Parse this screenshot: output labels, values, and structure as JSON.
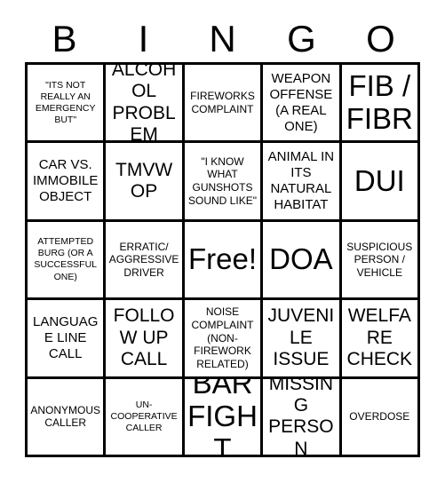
{
  "card": {
    "title": "BINGO",
    "header_letters": [
      "B",
      "I",
      "N",
      "G",
      "O"
    ],
    "free_space_index": 12,
    "colors": {
      "border": "#000000",
      "cell_background": "#ffffff",
      "text": "#000000",
      "page_background": "#ffffff"
    },
    "grid_size": "5x5",
    "cells": [
      {
        "text": "\"ITS NOT REALLY AN EMERGENCY BUT\"",
        "size": "xs",
        "column": "B",
        "row": 1
      },
      {
        "text": "ALCOHOL PROBLEM",
        "size": "lg",
        "column": "I",
        "row": 1
      },
      {
        "text": "FIREWORKS COMPLAINT",
        "size": "sm",
        "column": "N",
        "row": 1
      },
      {
        "text": "WEAPON OFFENSE (A REAL ONE)",
        "size": "md",
        "column": "G",
        "row": 1
      },
      {
        "text": "FIB / FIBR",
        "size": "xxl",
        "column": "O",
        "row": 1
      },
      {
        "text": "CAR VS. IMMOBILE OBJECT",
        "size": "md",
        "column": "B",
        "row": 2
      },
      {
        "text": "TMVWOP",
        "size": "lg",
        "column": "I",
        "row": 2
      },
      {
        "text": "\"I KNOW WHAT GUNSHOTS SOUND LIKE\"",
        "size": "sm",
        "column": "N",
        "row": 2
      },
      {
        "text": "ANIMAL IN ITS NATURAL HABITAT",
        "size": "md",
        "column": "G",
        "row": 2
      },
      {
        "text": "DUI",
        "size": "xxl",
        "column": "O",
        "row": 2
      },
      {
        "text": "ATTEMPTED BURG (OR A SUCCESSFUL ONE)",
        "size": "xs",
        "column": "B",
        "row": 3
      },
      {
        "text": "ERRATIC/ AGGRESSIVE DRIVER",
        "size": "sm",
        "column": "I",
        "row": 3
      },
      {
        "text": "Free!",
        "size": "xxl",
        "column": "N",
        "row": 3
      },
      {
        "text": "DOA",
        "size": "xxl",
        "column": "G",
        "row": 3
      },
      {
        "text": "SUSPICIOUS PERSON / VEHICLE",
        "size": "sm",
        "column": "O",
        "row": 3
      },
      {
        "text": "LANGUAGE LINE CALL",
        "size": "md",
        "column": "B",
        "row": 4
      },
      {
        "text": "FOLLOW UP CALL",
        "size": "lg",
        "column": "I",
        "row": 4
      },
      {
        "text": "NOISE COMPLAINT (NON-FIREWORK RELATED)",
        "size": "sm",
        "column": "N",
        "row": 4
      },
      {
        "text": "JUVENILE ISSUE",
        "size": "lg",
        "column": "G",
        "row": 4
      },
      {
        "text": "WELFARE CHECK",
        "size": "lg",
        "column": "O",
        "row": 4
      },
      {
        "text": "ANONYMOUS CALLER",
        "size": "sm",
        "column": "B",
        "row": 5
      },
      {
        "text": "UN-COOPERATIVE CALLER",
        "size": "xs",
        "column": "I",
        "row": 5
      },
      {
        "text": "BAR FIGHT",
        "size": "xxl",
        "column": "N",
        "row": 5
      },
      {
        "text": "MISSING PERSON",
        "size": "lg",
        "column": "G",
        "row": 5
      },
      {
        "text": "OVERDOSE",
        "size": "sm",
        "column": "O",
        "row": 5
      }
    ]
  }
}
